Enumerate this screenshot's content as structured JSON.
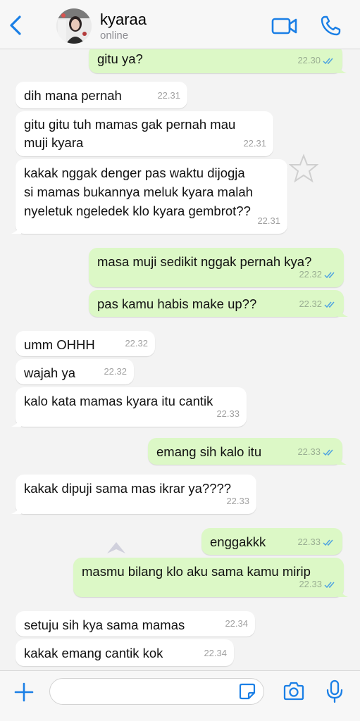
{
  "header": {
    "contact_name": "kyaraa",
    "status": "online",
    "icons": [
      "chevron-left-icon",
      "video-camera-icon",
      "phone-icon"
    ]
  },
  "colors": {
    "accent": "#1a7fe6",
    "incoming_bubble": "#ffffff",
    "outgoing_bubble": "#dcf8c6",
    "read_ticks": "#4fa3e0"
  },
  "messages": [
    {
      "dir": "out",
      "text": "gitu ya?",
      "time": "22.30"
    },
    {
      "dir": "in",
      "text": "dih mana pernah",
      "time": "22.31"
    },
    {
      "dir": "in",
      "text": "gitu gitu tuh mamas gak pernah mau\nmuji kyara",
      "time": "22.31"
    },
    {
      "dir": "in",
      "text": "kakak nggak denger pas waktu dijogja\nsi mamas bukannya meluk kyara malah\nnyeletuk ngeledek klo kyara gembrot??",
      "time": "22.31"
    },
    {
      "dir": "out",
      "text": "masa muji sedikit nggak pernah kya?",
      "time": "22.32"
    },
    {
      "dir": "out",
      "text": "pas kamu habis make up??",
      "time": "22.32"
    },
    {
      "dir": "in",
      "text": "umm OHHH",
      "time": "22.32"
    },
    {
      "dir": "in",
      "text": "wajah ya",
      "time": "22.32"
    },
    {
      "dir": "in",
      "text": "kalo kata mamas kyara itu cantik",
      "time": "22.33"
    },
    {
      "dir": "out",
      "text": "emang sih kalo itu",
      "time": "22.33"
    },
    {
      "dir": "in",
      "text": "kakak dipuji sama mas ikrar ya????",
      "time": "22.33"
    },
    {
      "dir": "out",
      "text": "enggakkk",
      "time": "22.33"
    },
    {
      "dir": "out",
      "text": "masmu bilang klo aku sama kamu mirip",
      "time": "22.33"
    },
    {
      "dir": "in",
      "text": "setuju sih kya sama mamas",
      "time": "22.34"
    },
    {
      "dir": "in",
      "text": "kakak emang cantik kok",
      "time": "22.34"
    }
  ],
  "composer": {
    "input_value": "",
    "icons": [
      "plus-icon",
      "sticker-icon",
      "camera-icon",
      "microphone-icon"
    ]
  }
}
